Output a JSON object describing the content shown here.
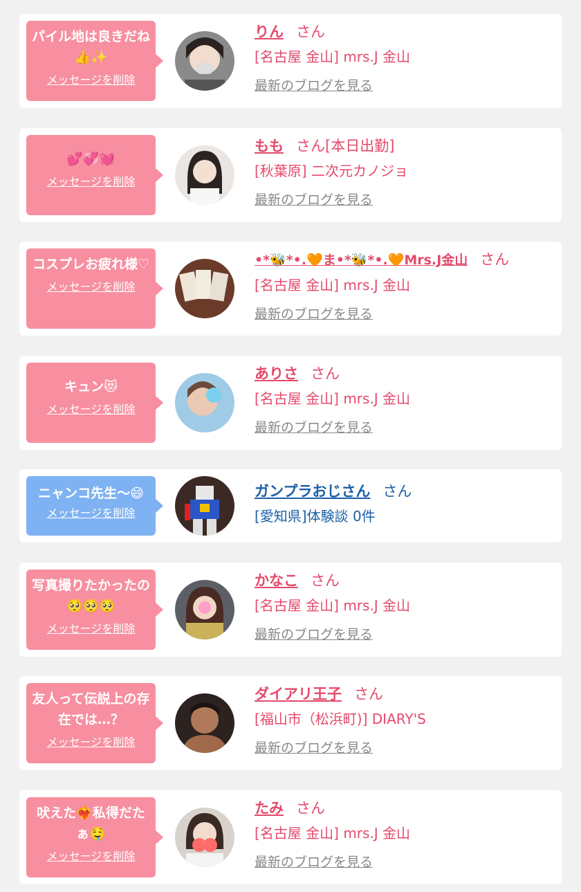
{
  "cards": [
    {
      "message": "パイル地は良きだね👍✨",
      "delete_label": "メッセージを削除",
      "name": "りん",
      "honorific": "さん",
      "shop": "[名古屋 金山] mrs.J 金山",
      "blog": "最新のブログを見る",
      "theme": "pink"
    },
    {
      "message": "💕💞💓",
      "delete_label": "メッセージを削除",
      "name": "もも",
      "honorific": "さん[本日出勤]",
      "shop": "[秋葉原] 二次元カノジョ",
      "blog": "最新のブログを見る",
      "theme": "pink"
    },
    {
      "message": "コスプレお疲れ様♡",
      "delete_label": "メッセージを削除",
      "name": "•*🐝*•.🧡ま•*🐝*•.🧡Mrs.J金山",
      "honorific": "さん",
      "shop": "[名古屋 金山] mrs.J 金山",
      "blog": "最新のブログを見る",
      "theme": "pink"
    },
    {
      "message": "キュン😻",
      "delete_label": "メッセージを削除",
      "name": "ありさ",
      "honorific": "さん",
      "shop": "[名古屋 金山] mrs.J 金山",
      "blog": "最新のブログを見る",
      "theme": "pink"
    },
    {
      "message": "ニャンコ先生〜😄",
      "delete_label": "メッセージを削除",
      "name": "ガンプラおじさん",
      "honorific": "さん",
      "shop": "[愛知県]体験談 0件",
      "blog": "",
      "theme": "blue"
    },
    {
      "message": "写真撮りたかったの🥺🥺🥺",
      "delete_label": "メッセージを削除",
      "name": "かなこ",
      "honorific": "さん",
      "shop": "[名古屋 金山] mrs.J 金山",
      "blog": "最新のブログを見る",
      "theme": "pink"
    },
    {
      "message": "友人って伝説上の存在では…？",
      "delete_label": "メッセージを削除",
      "name": "ダイアリ王子",
      "honorific": "さん",
      "shop": "[福山市（松浜町)] DIARY'S",
      "blog": "最新のブログを見る",
      "theme": "pink"
    },
    {
      "message": "吠えた❤️‍🔥私得だたぁ🤤",
      "delete_label": "メッセージを削除",
      "name": "たみ",
      "honorific": "さん",
      "shop": "[名古屋 金山] mrs.J 金山",
      "blog": "最新のブログを見る",
      "theme": "pink"
    }
  ],
  "colors": {
    "page_bg": "#f1f1f1",
    "card_bg": "#ffffff",
    "pink_bubble": "#f78fa0",
    "blue_bubble": "#7fb2f2",
    "pink_text": "#e44a6c",
    "blue_text": "#1c5fa8",
    "link_gray": "#888888"
  }
}
